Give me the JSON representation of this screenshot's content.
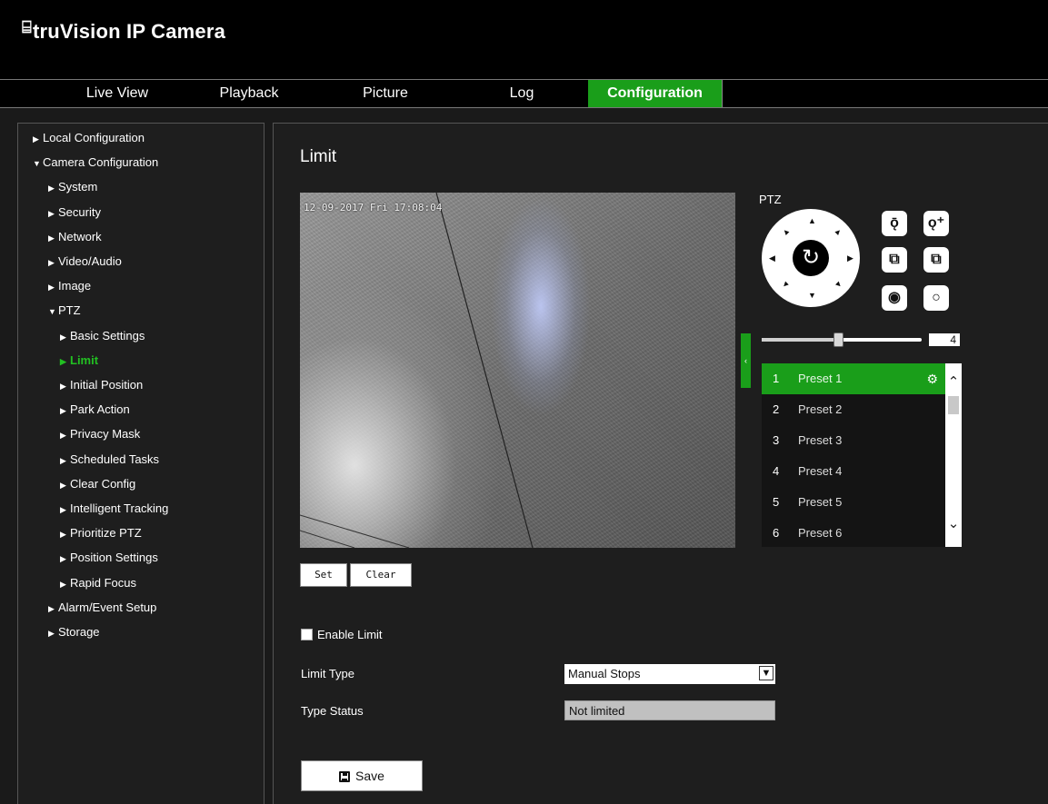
{
  "app": {
    "logo_icon": "⌸",
    "title": "truVision  IP Camera"
  },
  "nav": {
    "tabs": [
      {
        "label": "Live View"
      },
      {
        "label": "Playback"
      },
      {
        "label": "Picture"
      },
      {
        "label": "Log"
      },
      {
        "label": "Configuration",
        "active": true
      }
    ]
  },
  "sidebar": {
    "items": [
      {
        "label": "Local Configuration",
        "level": 0,
        "expanded": false
      },
      {
        "label": "Camera Configuration",
        "level": 0,
        "expanded": true
      },
      {
        "label": "System",
        "level": 1,
        "expanded": false
      },
      {
        "label": "Security",
        "level": 1,
        "expanded": false
      },
      {
        "label": "Network",
        "level": 1,
        "expanded": false
      },
      {
        "label": "Video/Audio",
        "level": 1,
        "expanded": false
      },
      {
        "label": "Image",
        "level": 1,
        "expanded": false
      },
      {
        "label": "PTZ",
        "level": 1,
        "expanded": true
      },
      {
        "label": "Basic Settings",
        "level": 2,
        "expanded": false
      },
      {
        "label": "Limit",
        "level": 2,
        "expanded": false,
        "active": true
      },
      {
        "label": "Initial Position",
        "level": 2,
        "expanded": false
      },
      {
        "label": "Park Action",
        "level": 2,
        "expanded": false
      },
      {
        "label": "Privacy Mask",
        "level": 2,
        "expanded": false
      },
      {
        "label": "Scheduled Tasks",
        "level": 2,
        "expanded": false
      },
      {
        "label": "Clear Config",
        "level": 2,
        "expanded": false
      },
      {
        "label": "Intelligent Tracking",
        "level": 2,
        "expanded": false
      },
      {
        "label": "Prioritize PTZ",
        "level": 2,
        "expanded": false
      },
      {
        "label": "Position Settings",
        "level": 2,
        "expanded": false
      },
      {
        "label": "Rapid Focus",
        "level": 2,
        "expanded": false
      },
      {
        "label": "Alarm/Event Setup",
        "level": 1,
        "expanded": false
      },
      {
        "label": "Storage",
        "level": 1,
        "expanded": false
      }
    ]
  },
  "main": {
    "title": "Limit",
    "video": {
      "timestamp": "12-09-2017 Fri 17:08:04"
    },
    "buttons": {
      "set": "Set",
      "clear": "Clear"
    },
    "ptz": {
      "label": "PTZ",
      "center_icon": "↻",
      "controls": [
        {
          "icon": "zoom-out-icon",
          "glyph": "ǭ"
        },
        {
          "icon": "zoom-in-icon",
          "glyph": "ǫ⁺"
        },
        {
          "icon": "focus-near-icon",
          "glyph": "⧉"
        },
        {
          "icon": "focus-far-icon",
          "glyph": "⧉"
        },
        {
          "icon": "iris-open-icon",
          "glyph": "◉"
        },
        {
          "icon": "iris-close-icon",
          "glyph": "○"
        }
      ],
      "speed": {
        "value": "4",
        "level": 0.5
      }
    },
    "presets": [
      {
        "num": "1",
        "name": "Preset 1",
        "active": true
      },
      {
        "num": "2",
        "name": "Preset 2"
      },
      {
        "num": "3",
        "name": "Preset 3"
      },
      {
        "num": "4",
        "name": "Preset 4"
      },
      {
        "num": "5",
        "name": "Preset 5"
      },
      {
        "num": "6",
        "name": "Preset 6"
      }
    ],
    "form": {
      "enable_label": "Enable Limit",
      "enable_checked": false,
      "limit_type_label": "Limit Type",
      "limit_type_value": "Manual Stops",
      "type_status_label": "Type Status",
      "type_status_value": "Not limited",
      "save_label": "Save"
    }
  },
  "colors": {
    "accent": "#1a9e1a",
    "background": "#1e1e1e",
    "header": "#000000"
  }
}
